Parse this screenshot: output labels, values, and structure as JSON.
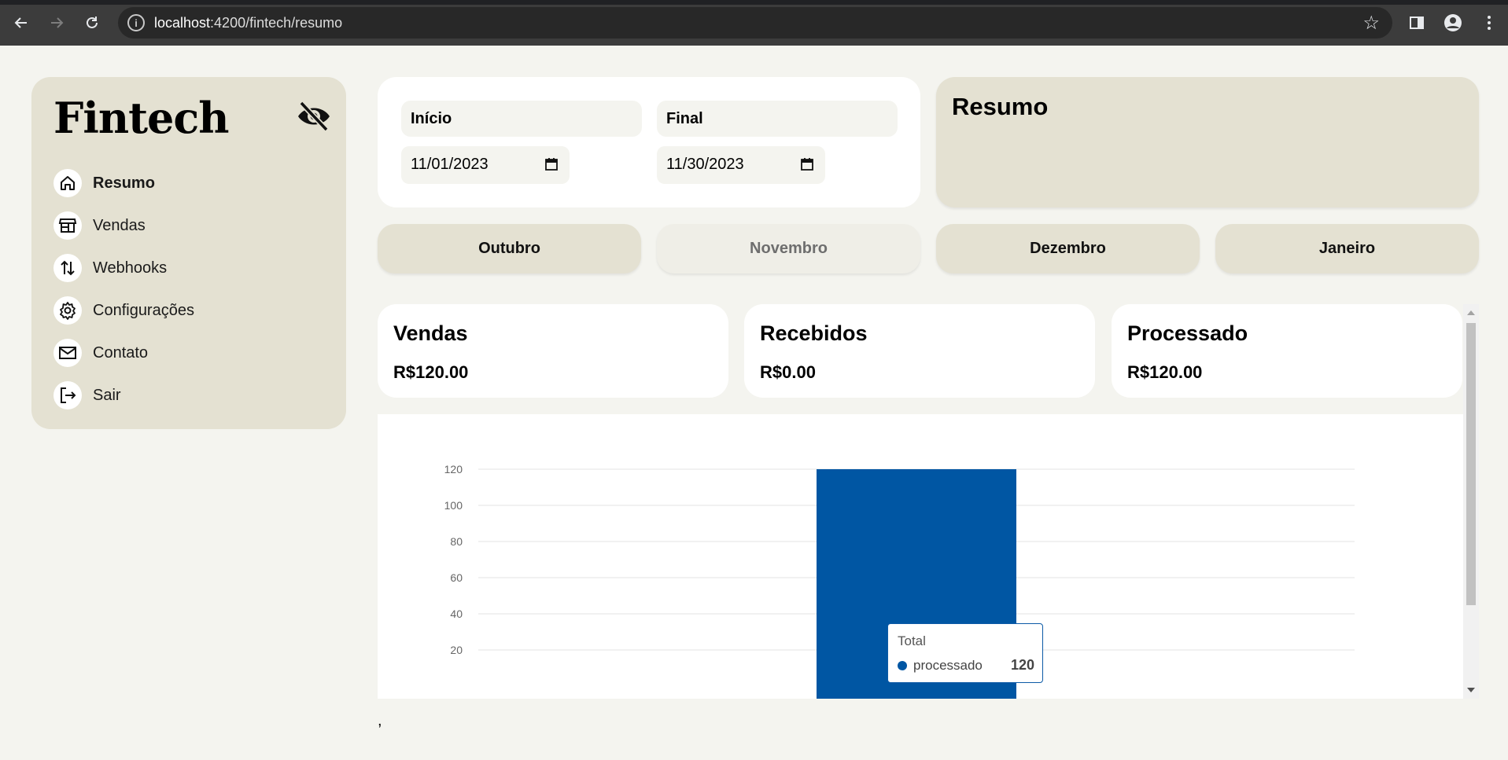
{
  "browser": {
    "url_host": "localhost",
    "url_path": ":4200/fintech/resumo"
  },
  "sidebar": {
    "logo": "Fintech",
    "items": [
      {
        "label": "Resumo",
        "icon": "home-icon",
        "active": true
      },
      {
        "label": "Vendas",
        "icon": "store-icon",
        "active": false
      },
      {
        "label": "Webhooks",
        "icon": "arrows-up-down-icon",
        "active": false
      },
      {
        "label": "Configurações",
        "icon": "gear-icon",
        "active": false
      },
      {
        "label": "Contato",
        "icon": "mail-icon",
        "active": false
      },
      {
        "label": "Sair",
        "icon": "logout-icon",
        "active": false
      }
    ]
  },
  "dates": {
    "start_label": "Início",
    "start_value": "11/01/2023",
    "end_label": "Final",
    "end_value": "11/30/2023"
  },
  "resumo": {
    "title": "Resumo"
  },
  "months": [
    {
      "label": "Outubro",
      "current": false
    },
    {
      "label": "Novembro",
      "current": true
    },
    {
      "label": "Dezembro",
      "current": false
    },
    {
      "label": "Janeiro",
      "current": false
    }
  ],
  "stats": [
    {
      "title": "Vendas",
      "value": "R$120.00"
    },
    {
      "title": "Recebidos",
      "value": "R$0.00"
    },
    {
      "title": "Processado",
      "value": "R$120.00"
    }
  ],
  "chart_data": {
    "type": "bar",
    "categories": [
      "Total"
    ],
    "series": [
      {
        "name": "processado",
        "values": [
          120
        ],
        "color": "#0056a3"
      }
    ],
    "yticks": [
      20,
      40,
      60,
      80,
      100,
      120
    ],
    "ylim": [
      0,
      120
    ],
    "grid": true
  },
  "tooltip": {
    "title": "Total",
    "series": "processado",
    "value": "120"
  },
  "footer_text": ","
}
